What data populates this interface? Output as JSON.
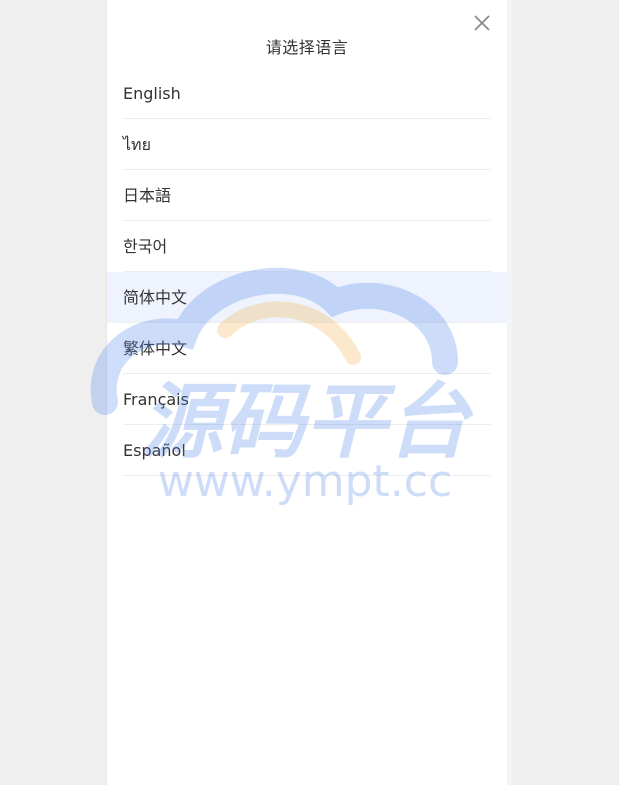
{
  "dialog": {
    "title": "请选择语言"
  },
  "languages": [
    {
      "label": "English"
    },
    {
      "label": "ไทย"
    },
    {
      "label": "日本語"
    },
    {
      "label": "한국어"
    },
    {
      "label": "简体中文",
      "selected": true
    },
    {
      "label": "繁体中文"
    },
    {
      "label": "Français"
    },
    {
      "label": "Español"
    }
  ],
  "watermark": {
    "main": "源码平台",
    "url": "www.ympt.cc"
  },
  "colors": {
    "background": "#efefef",
    "panel": "#ffffff",
    "selected_row": "#eef3fd",
    "text": "#333333",
    "divider": "#ededed",
    "watermark_blue": "#4f86e8",
    "watermark_orange": "#f5b04a"
  }
}
